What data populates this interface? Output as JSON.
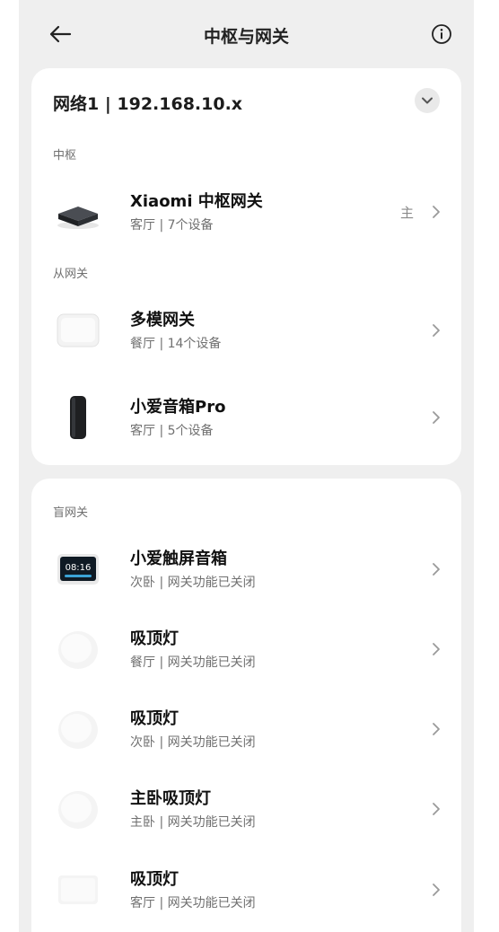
{
  "header": {
    "title": "中枢与网关",
    "back_icon": "back-arrow-icon",
    "info_icon": "info-icon"
  },
  "network": {
    "title": "网络1 | 192.168.10.x",
    "collapse_icon": "chevron-down-icon"
  },
  "hub_section": {
    "label": "中枢",
    "items": [
      {
        "name": "Xiaomi 中枢网关",
        "detail": "客厅 | 7个设备",
        "badge": "主",
        "icon": "hub-gateway-icon"
      }
    ]
  },
  "sub_gateway_section": {
    "label": "从网关",
    "items": [
      {
        "name": "多模网关",
        "detail": "餐厅 | 14个设备",
        "icon": "multimode-gateway-icon"
      },
      {
        "name": "小爱音箱Pro",
        "detail": "客厅 | 5个设备",
        "icon": "smart-speaker-icon"
      }
    ]
  },
  "blind_gateway_section": {
    "label": "盲网关",
    "items": [
      {
        "name": "小爱触屏音箱",
        "detail": "次卧 | 网关功能已关闭",
        "icon": "touchscreen-speaker-icon",
        "screen_time": "08:16"
      },
      {
        "name": "吸顶灯",
        "detail": "餐厅 | 网关功能已关闭",
        "icon": "ceiling-light-icon"
      },
      {
        "name": "吸顶灯",
        "detail": "次卧 | 网关功能已关闭",
        "icon": "ceiling-light-icon"
      },
      {
        "name": "主卧吸顶灯",
        "detail": "主卧 | 网关功能已关闭",
        "icon": "ceiling-light-icon"
      },
      {
        "name": "吸顶灯",
        "detail": "客厅 | 网关功能已关闭",
        "icon": "square-ceiling-light-icon"
      }
    ]
  },
  "colors": {
    "background": "#efefef",
    "card": "#ffffff",
    "text_primary": "#111111",
    "text_secondary": "#707070"
  }
}
